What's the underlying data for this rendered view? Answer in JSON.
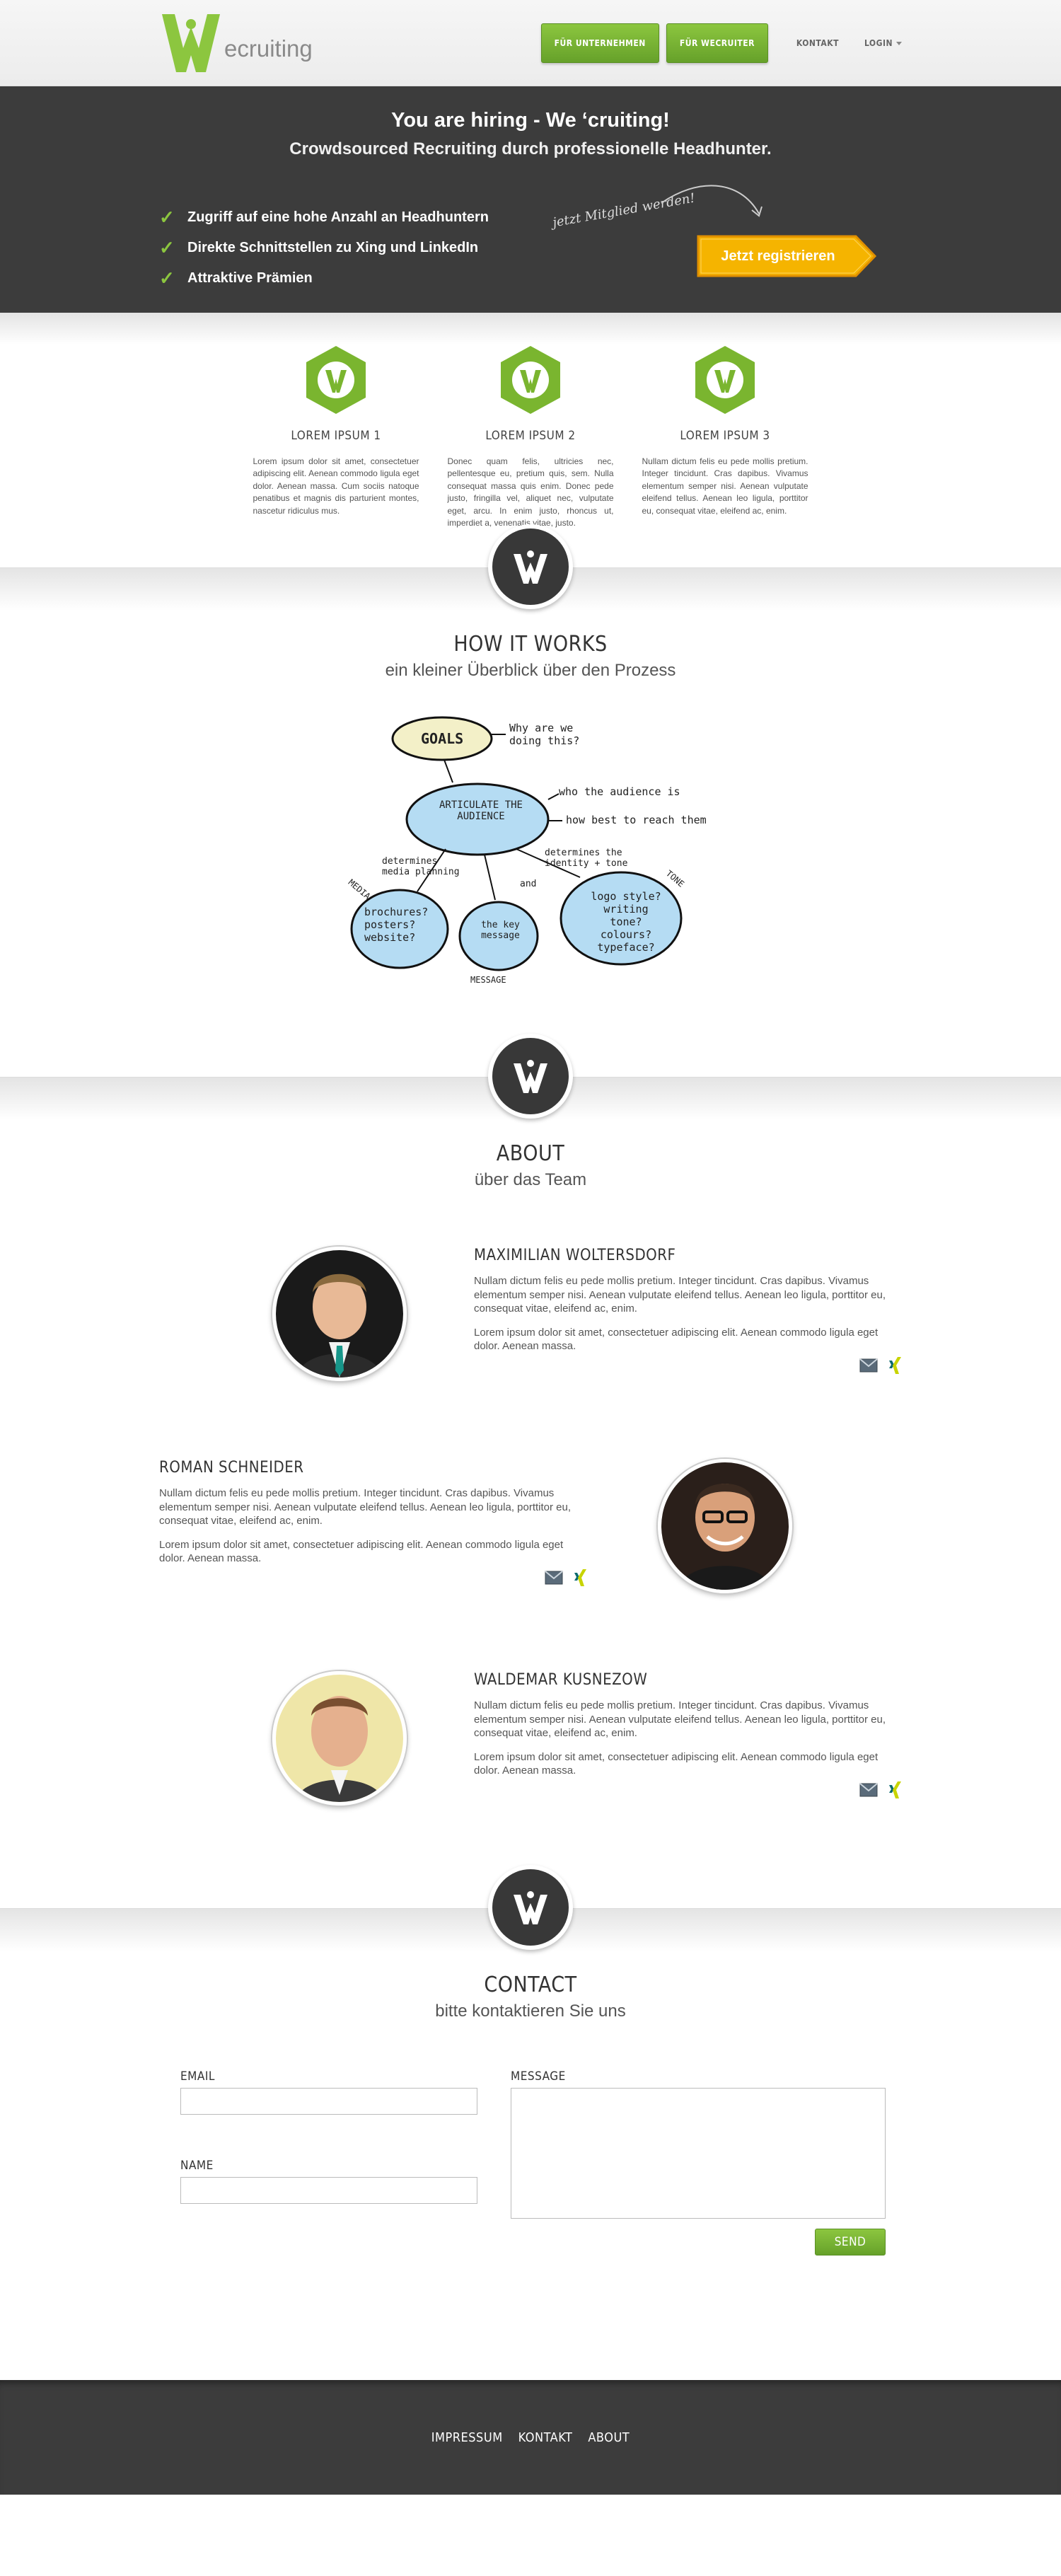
{
  "header": {
    "logo_text": "ecruiting",
    "nav": {
      "companies": "FÜR UNTERNEHMEN",
      "recruiters": "FÜR WECRUITER",
      "contact": "KONTAKT",
      "login": "LOGIN"
    }
  },
  "hero": {
    "title": "You are hiring - We ‘cruiting!",
    "subtitle": "Crowdsourced Recruiting durch professionelle Headhunter.",
    "checks": [
      "Zugriff auf eine hohe Anzahl an Headhuntern",
      "Direkte Schnittstellen zu Xing und LinkedIn",
      "Attraktive Prämien"
    ],
    "member_note": "jetzt Mitglied werden!",
    "register_button": "Jetzt registrieren"
  },
  "features": [
    {
      "title": "LOREM IPSUM 1",
      "text": "Lorem ipsum dolor sit amet, consectetuer adipiscing elit. Aenean commodo ligula eget dolor. Aenean massa. Cum sociis natoque penatibus et magnis dis parturient montes, nascetur ridiculus mus."
    },
    {
      "title": "LOREM IPSUM 2",
      "text": "Donec quam felis, ultricies nec, pellentesque eu, pretium quis, sem. Nulla consequat massa quis enim. Donec pede justo, fringilla vel, aliquet nec, vulputate eget, arcu. In enim justo, rhoncus ut, imperdiet a, venenatis vitae, justo."
    },
    {
      "title": "LOREM IPSUM 3",
      "text": "Nullam dictum felis eu pede mollis pretium. Integer tincidunt. Cras dapibus. Vivamus elementum semper nisi. Aenean vulputate eleifend tellus. Aenean leo ligula, porttitor eu, consequat vitae, eleifend ac, enim."
    }
  ],
  "how": {
    "title": "HOW IT WORKS",
    "subtitle": "ein kleiner Überblick über den Prozess",
    "diagram": {
      "goals": "GOALS",
      "why": "Why are we doing this?",
      "articulate": "ARTICULATE THE AUDIENCE",
      "who": "who the audience is",
      "how_best": "how best to reach them",
      "determines_media": "determines media planning",
      "and": "and",
      "determines_identity": "determines the identity + tone",
      "media": "MEDIA",
      "media_list": "brochures? posters? website?",
      "message": "MESSAGE",
      "key_message": "the key message",
      "tone": "TONE",
      "tone_list": "logo style? writing tone? colours? typeface?"
    }
  },
  "about": {
    "title": "ABOUT",
    "subtitle": "über das Team",
    "members": [
      {
        "name": "MAXIMILIAN WOLTERSDORF",
        "p1": "Nullam dictum felis eu pede mollis pretium. Integer tincidunt. Cras dapibus. Vivamus elementum semper nisi. Aenean vulputate eleifend tellus. Aenean leo ligula, porttitor eu, consequat vitae, eleifend ac, enim.",
        "p2": "Lorem ipsum dolor sit amet, consectetuer adipiscing elit. Aenean commodo ligula eget dolor. Aenean massa."
      },
      {
        "name": "ROMAN SCHNEIDER",
        "p1": "Nullam dictum felis eu pede mollis pretium. Integer tincidunt. Cras dapibus. Vivamus elementum semper nisi. Aenean vulputate eleifend tellus. Aenean leo ligula, porttitor eu, consequat vitae, eleifend ac, enim.",
        "p2": "Lorem ipsum dolor sit amet, consectetuer adipiscing elit. Aenean commodo ligula eget dolor. Aenean massa."
      },
      {
        "name": "WALDEMAR KUSNEZOW",
        "p1": "Nullam dictum felis eu pede mollis pretium. Integer tincidunt. Cras dapibus. Vivamus elementum semper nisi. Aenean vulputate eleifend tellus. Aenean leo ligula, porttitor eu, consequat vitae, eleifend ac, enim.",
        "p2": "Lorem ipsum dolor sit amet, consectetuer adipiscing elit. Aenean commodo ligula eget dolor. Aenean massa."
      }
    ]
  },
  "contact": {
    "title": "CONTACT",
    "subtitle": "bitte kontaktieren Sie uns",
    "email_label": "EMAIL",
    "name_label": "NAME",
    "message_label": "MESSAGE",
    "send": "SEND"
  },
  "footer": {
    "links": [
      "IMPRESSUM",
      "KONTAKT",
      "ABOUT"
    ]
  },
  "colors": {
    "brand_green": "#8cc63f",
    "dark": "#3c3c3c",
    "cta_yellow": "#f5b400"
  }
}
